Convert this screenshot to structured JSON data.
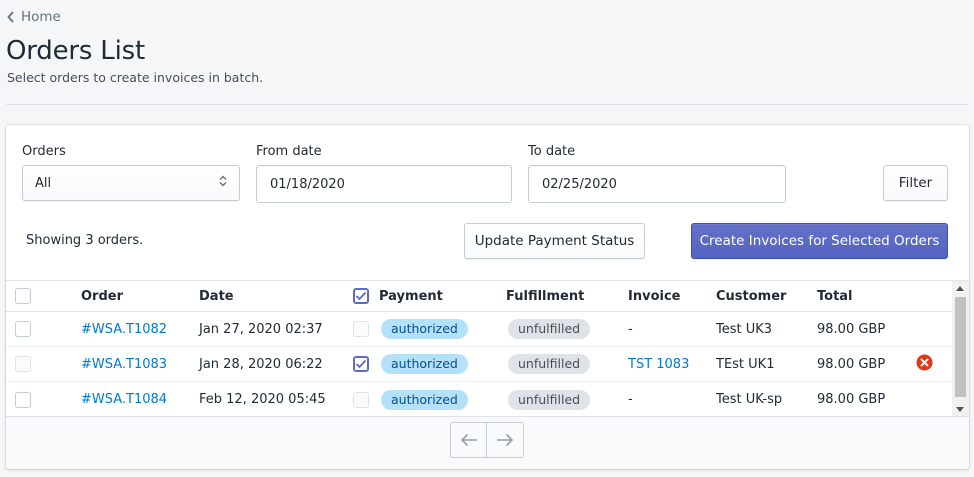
{
  "breadcrumb": {
    "label": "Home"
  },
  "page": {
    "title": "Orders List",
    "subtitle": "Select orders to create invoices in batch."
  },
  "filters": {
    "orders_label": "Orders",
    "orders_value": "All",
    "from_label": "From date",
    "from_value": "01/18/2020",
    "to_label": "To date",
    "to_value": "02/25/2020",
    "filter_button": "Filter"
  },
  "summary": {
    "prefix": "Showing ",
    "count": "3",
    "suffix": " orders."
  },
  "actions": {
    "update_payment": "Update Payment Status",
    "create_invoices": "Create Invoices for Selected Orders"
  },
  "table": {
    "headers": [
      "Order",
      "Date",
      "Payment",
      "Fulfillment",
      "Invoice",
      "Customer",
      "Total"
    ],
    "rows": [
      {
        "order": "#WSA.T1082",
        "date": "Jan 27, 2020 02:37",
        "payment": "authorized",
        "fulfillment": "unfulfilled",
        "invoice": "-",
        "customer": "Test UK3",
        "total": "98.00 GBP"
      },
      {
        "order": "#WSA.T1083",
        "date": "Jan 28, 2020 06:22",
        "payment": "authorized",
        "fulfillment": "unfulfilled",
        "invoice": "TST 1083",
        "customer": "TEst UK1",
        "total": "98.00 GBP"
      },
      {
        "order": "#WSA.T1084",
        "date": "Feb 12, 2020 05:45",
        "payment": "authorized",
        "fulfillment": "unfulfilled",
        "invoice": "-",
        "customer": "Test UK-sp",
        "total": "98.00 GBP"
      }
    ]
  },
  "colors": {
    "primary": "#5c6ac4",
    "link": "#007ace",
    "payment_badge": "#b4e1fa",
    "fulfillment_badge": "#dfe3e8",
    "error": "#de3618"
  },
  "icons": [
    "chevron-left-icon",
    "select-arrows-icon",
    "checkmark-icon",
    "error-circle-icon",
    "arrow-left-icon",
    "arrow-right-icon"
  ]
}
